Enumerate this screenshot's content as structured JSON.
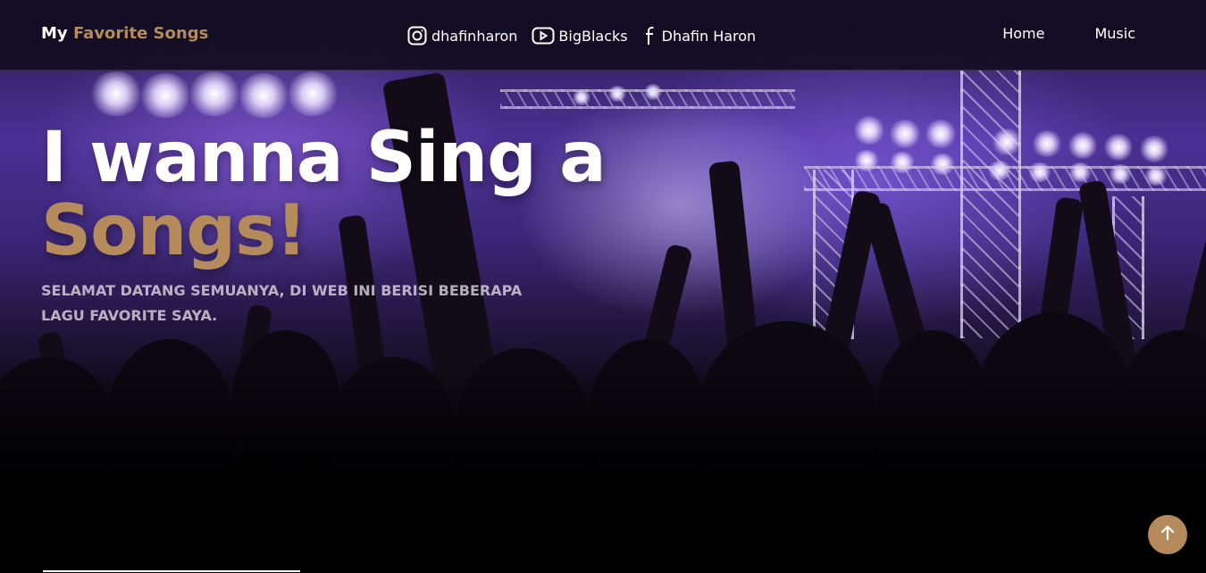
{
  "navbar": {
    "brand_prefix": "My",
    "brand_accent": "Favorite Songs",
    "social": [
      {
        "icon": "instagram-icon",
        "label": "dhafinharon"
      },
      {
        "icon": "youtube-icon",
        "label": "BigBlacks"
      },
      {
        "icon": "facebook-icon",
        "label": "Dhafin Haron"
      }
    ],
    "links": [
      {
        "label": "Home"
      },
      {
        "label": "Music"
      }
    ]
  },
  "hero": {
    "title_line1": "I wanna Sing a",
    "title_line2": "Songs!",
    "subtitle": "SELAMAT DATANG SEMUANYA, DI WEB INI BERISI BEBERAPA LAGU FAVORITE SAYA."
  },
  "back_to_top": {
    "icon": "arrow-up-icon"
  },
  "colors": {
    "accent": "#b58b5b",
    "navbar_bg": "#0e0a1a",
    "text": "#ffffff"
  }
}
